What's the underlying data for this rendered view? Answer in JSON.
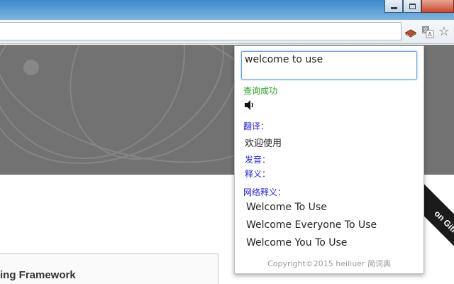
{
  "browser": {
    "window_controls": [
      "minimize-button",
      "maximize-button",
      "close-button"
    ],
    "extension_icons": [
      "book-icon",
      "translate-icon",
      "bookmark-star-icon"
    ]
  },
  "page": {
    "framework_text": "ing Framework",
    "ribbon_text": "on GitHub"
  },
  "popup": {
    "query_value": "welcome to use",
    "status": "查询成功",
    "translation_label": "翻译：",
    "translation_value": "欢迎使用",
    "pronunciation_label": "发音：",
    "definition_label": "释义：",
    "web_definition_label": "网络释义：",
    "web_definitions": [
      "Welcome To Use",
      "Welcome Everyone To Use",
      "Welcome You To Use"
    ],
    "footer": "Copyright©2015 heiliuer 简词典"
  },
  "colors": {
    "status_green": "#2a9d2a",
    "label_blue": "#2a2ad0",
    "hero_gray": "#727272",
    "titlebar_blue": "#5ea1d8"
  }
}
